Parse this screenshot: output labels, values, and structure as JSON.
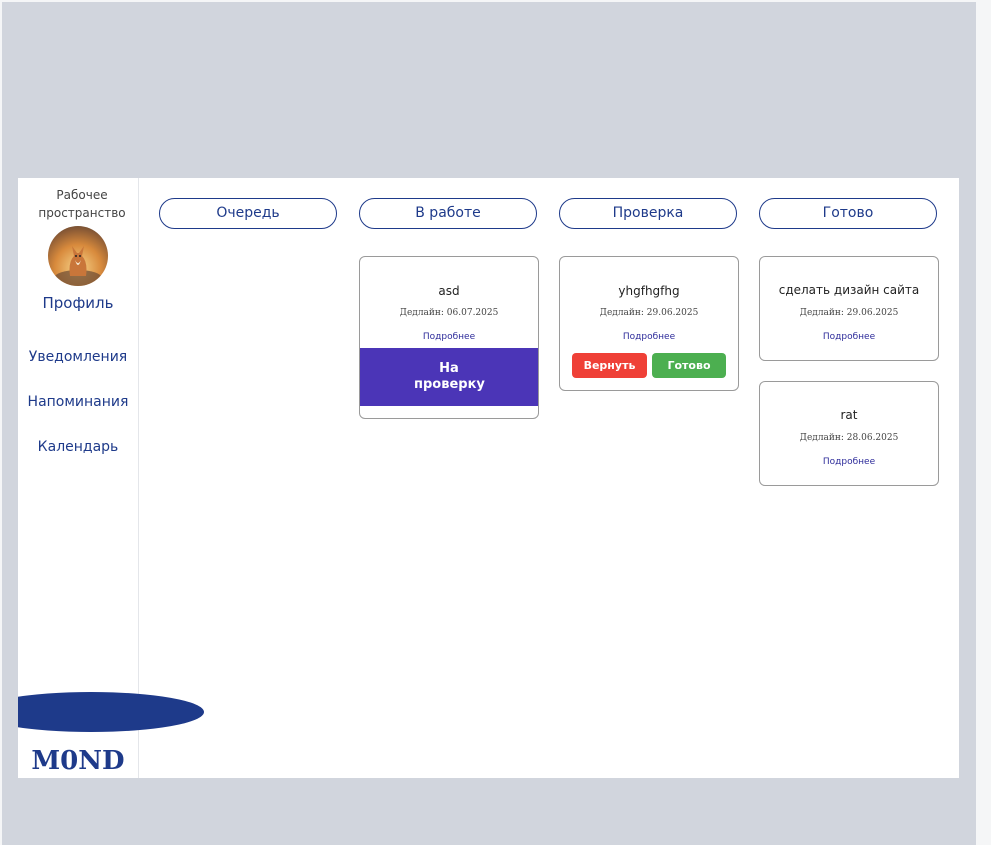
{
  "sidebar": {
    "workspace_title_line1": "Рабочее",
    "workspace_title_line2": "пространство",
    "profile_label": "Профиль",
    "nav": [
      {
        "label": "Уведомления"
      },
      {
        "label": "Напоминания"
      },
      {
        "label": "Календарь"
      }
    ],
    "logo": "M0ND"
  },
  "columns": [
    {
      "title": "Очередь",
      "cards": []
    },
    {
      "title": "В работе",
      "cards": [
        {
          "title": "asd",
          "deadline": "Дедлайн: 06.07.2025",
          "more": "Подробнее",
          "action": "На проверку"
        }
      ]
    },
    {
      "title": "Проверка",
      "cards": [
        {
          "title": "yhgfhgfhg",
          "deadline": "Дедлайн: 29.06.2025",
          "more": "Подробнее",
          "return_label": "Вернуть",
          "done_label": "Готово"
        }
      ]
    },
    {
      "title": "Готово",
      "cards": [
        {
          "title": "сделать дизайн сайта",
          "deadline": "Дедлайн: 29.06.2025",
          "more": "Подробнее"
        },
        {
          "title": "rat",
          "deadline": "Дедлайн: 28.06.2025",
          "more": "Подробнее"
        }
      ]
    }
  ],
  "colors": {
    "accent": "#1e3a8a",
    "review_button": "#4b35b7",
    "return_button": "#ef4037",
    "done_button": "#4caf50"
  }
}
